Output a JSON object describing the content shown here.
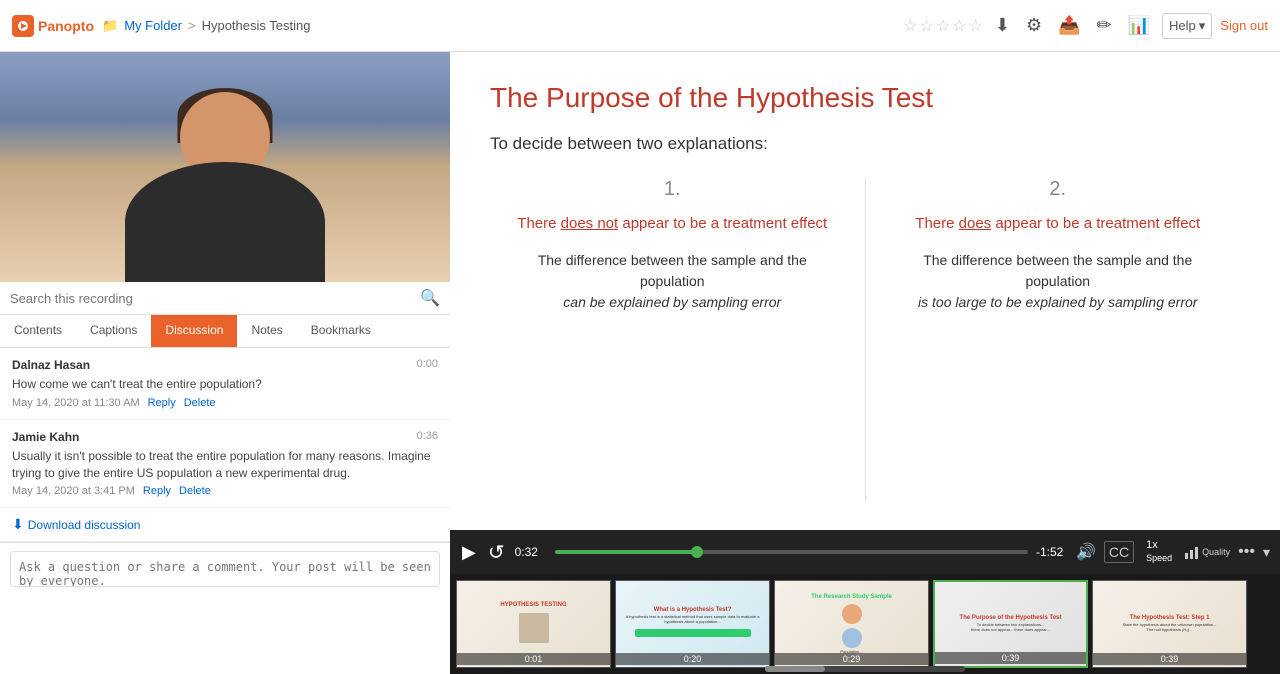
{
  "header": {
    "logo_text": "Panopto",
    "breadcrumb_folder": "My Folder",
    "breadcrumb_sep": ">",
    "breadcrumb_page": "Hypothesis Testing",
    "sign_out_label": "Sign out",
    "help_label": "Help"
  },
  "search": {
    "placeholder": "Search this recording"
  },
  "tabs": [
    {
      "label": "Contents",
      "active": false
    },
    {
      "label": "Captions",
      "active": false
    },
    {
      "label": "Discussion",
      "active": true
    },
    {
      "label": "Notes",
      "active": false
    },
    {
      "label": "Bookmarks",
      "active": false
    }
  ],
  "comments": [
    {
      "author": "Dalnaz Hasan",
      "time_badge": "0:00",
      "text": "How come we can't treat the entire population?",
      "date": "May 14, 2020 at 11:30 AM",
      "reply_label": "Reply",
      "delete_label": "Delete"
    },
    {
      "author": "Jamie Kahn",
      "time_badge": "0:36",
      "text": "Usually it isn't possible to treat the entire population for many reasons. Imagine trying to give the entire US population a new experimental drug.",
      "date": "May 14, 2020 at 3:41 PM",
      "reply_label": "Reply",
      "delete_label": "Delete"
    }
  ],
  "download_label": "Download discussion",
  "comment_placeholder": "Ask a question or share a comment. Your post will be seen by everyone.",
  "slide": {
    "title": "The Purpose of the Hypothesis Test",
    "subtitle": "To decide between two explanations:",
    "col1_number": "1.",
    "col1_title": "There does not appear to be a treatment effect",
    "col1_body": "The difference between the sample and the population can be explained by sampling error",
    "col2_number": "2.",
    "col2_title": "There does appear to be a treatment effect",
    "col2_body": "The difference between the sample and the population is too large to be explained by sampling error"
  },
  "controls": {
    "current_time": "0:32",
    "remaining_time": "-1:52",
    "speed_label": "1x\nSpeed",
    "quality_label": "Quality"
  },
  "filmstrip": [
    {
      "label": "0:01",
      "title": "HYPOTHESIS TESTING",
      "type": "1"
    },
    {
      "label": "0:20",
      "title": "What is a Hypothesis Test?",
      "type": "2"
    },
    {
      "label": "0:29",
      "title": "The Research Study Sample",
      "type": "3"
    },
    {
      "label": "0:39",
      "title": "The Purpose of the Hypothesis Test",
      "type": "4",
      "active": true
    },
    {
      "label": "0:39",
      "title": "The Hypothesis Test: Step 1",
      "type": "5"
    }
  ]
}
